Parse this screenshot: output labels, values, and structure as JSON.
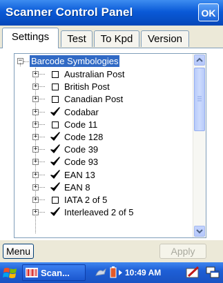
{
  "window": {
    "title": "Scanner Control Panel",
    "ok_label": "OK"
  },
  "tabs": [
    {
      "label": "Settings",
      "active": true
    },
    {
      "label": "Test",
      "active": false
    },
    {
      "label": "To Kpd",
      "active": false
    },
    {
      "label": "Version",
      "active": false
    }
  ],
  "tree": {
    "root": {
      "label": "Barcode Symbologies",
      "expander": "−"
    },
    "items": [
      {
        "label": "Australian Post",
        "checked": false
      },
      {
        "label": "British Post",
        "checked": false
      },
      {
        "label": "Canadian Post",
        "checked": false
      },
      {
        "label": "Codabar",
        "checked": true
      },
      {
        "label": "Code 11",
        "checked": false
      },
      {
        "label": "Code 128",
        "checked": true
      },
      {
        "label": "Code 39",
        "checked": true
      },
      {
        "label": "Code 93",
        "checked": true
      },
      {
        "label": "EAN 13",
        "checked": true
      },
      {
        "label": "EAN 8",
        "checked": true
      },
      {
        "label": "IATA 2 of 5",
        "checked": false
      },
      {
        "label": "Interleaved 2 of 5",
        "checked": true
      }
    ],
    "expander_symbol": "+"
  },
  "bottom": {
    "menu_label": "Menu",
    "apply_label": "Apply"
  },
  "taskbar": {
    "task_label": "Scan...",
    "clock": "10:49 AM"
  },
  "colors": {
    "title_bar": "#0a5ad8",
    "selection": "#316ac5",
    "check_mark": "#000000"
  }
}
